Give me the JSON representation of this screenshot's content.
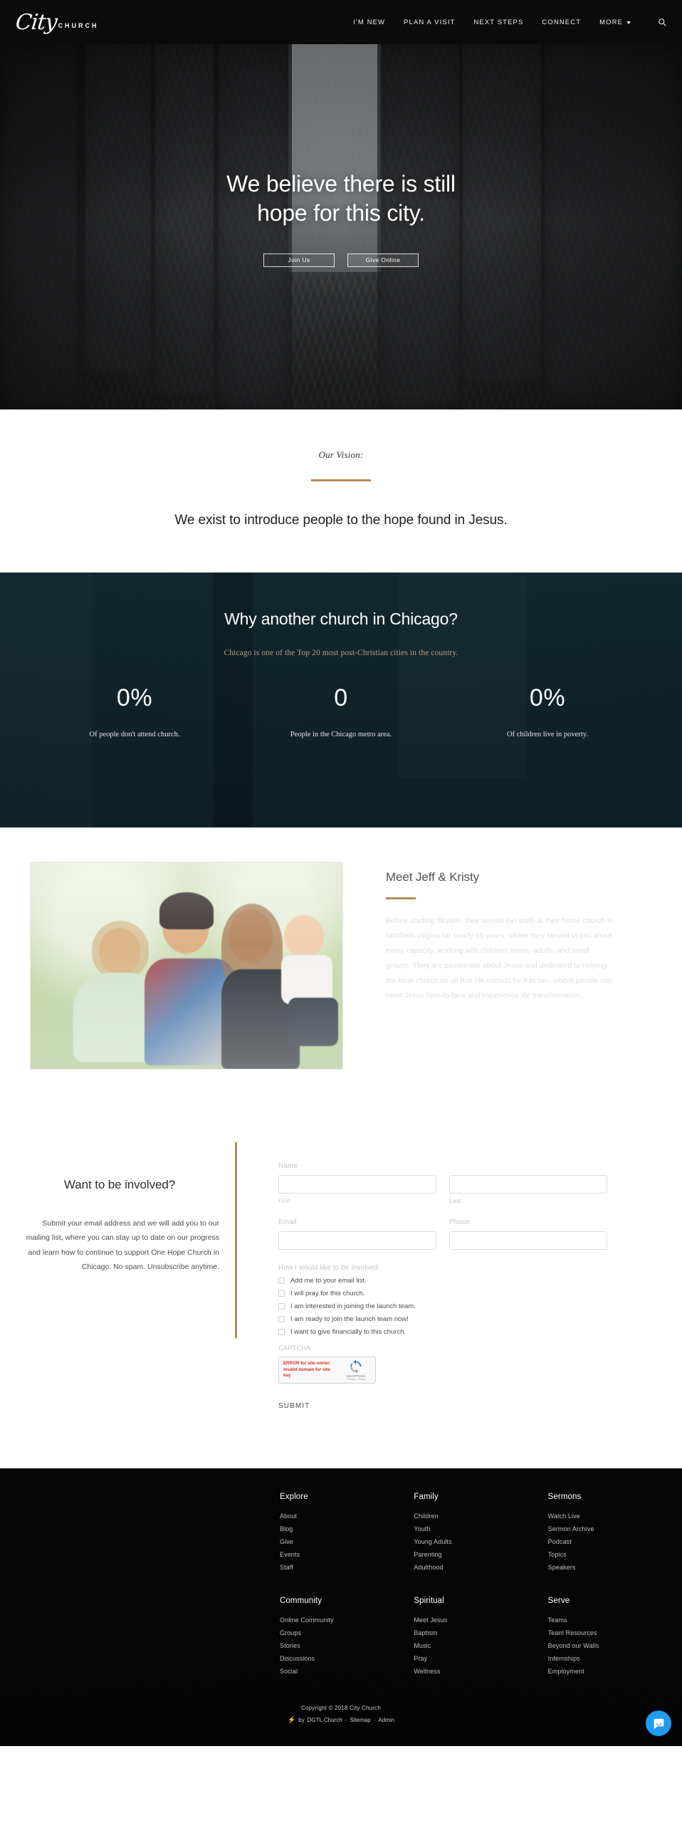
{
  "header": {
    "brand_script": "City",
    "brand_sub": "CHURCH",
    "nav": [
      {
        "label": "I'M NEW",
        "has_chevron": false
      },
      {
        "label": "PLAN A VISIT",
        "has_chevron": false
      },
      {
        "label": "NEXT STEPS",
        "has_chevron": false
      },
      {
        "label": "CONNECT",
        "has_chevron": false
      },
      {
        "label": "MORE",
        "has_chevron": true
      }
    ],
    "search_icon": "search-icon"
  },
  "hero": {
    "title_line1": "We believe there is still",
    "title_line2": "hope for this city.",
    "btn_join": "Join Us",
    "btn_give": "Give Online"
  },
  "vision": {
    "eyebrow": "Our Vision:",
    "statement": "We exist to introduce people to the hope found in Jesus.",
    "accent_color": "#b08d57"
  },
  "stats": {
    "title": "Why another church in Chicago?",
    "subtitle": "Chicago is one of the Top 20 most post-Christian cities in the country.",
    "subtitle_color": "#b3a07c",
    "items": [
      {
        "value": "0%",
        "label": "Of people don't attend church."
      },
      {
        "value": "0",
        "label": "People in the Chicago metro area."
      },
      {
        "value": "0%",
        "label": "Of children live in poverty."
      }
    ]
  },
  "meet": {
    "photo_alt": "family-photo",
    "title": "Meet Jeff & Kristy",
    "body": "Before starting Skyline, they served (on staff) at their home church in Northern Virgina for nearly 15 years, where they served in just about every capacity, working with children, teens, adults, and small groups. They are passionate about Jesus and dedicated to helping the local church be all that He intends for it to be—where people can meet Jesus face-to-face and experience life transformation."
  },
  "involve": {
    "title": "Want to be involved?",
    "copy": "Submit your email address and we will add you to our mailing list, where you can stay up to date on our progress and learn how to continue to support One Hope Church in Chicago. No spam. Unsubscribe anytime.",
    "form": {
      "name_label": "Name",
      "first_sub": "First",
      "last_sub": "Last",
      "first_value": "",
      "last_value": "",
      "email_label": "Email",
      "email_value": "",
      "phone_label": "Phone",
      "phone_value": "",
      "involved_label": "How I would like to be involved:",
      "checkboxes": [
        {
          "label": "Add me to your email list.",
          "checked": false
        },
        {
          "label": "I will pray for this church.",
          "checked": false
        },
        {
          "label": "I am interested in joining the launch team.",
          "checked": false
        },
        {
          "label": "I am ready to join the launch team now!",
          "checked": false
        },
        {
          "label": "I want to give financially to this church.",
          "checked": false
        }
      ],
      "captcha_label": "CAPTCHA",
      "captcha_error_line1": "ERROR for site owner:",
      "captcha_error_line2": "Invalid domain for site key",
      "captcha_brand": "reCAPTCHA",
      "captcha_terms": "Privacy - Terms",
      "captcha_error_color": "#d93025",
      "submit_label": "SUBMIT"
    }
  },
  "footer": {
    "columns_row1": [
      {
        "title": "Explore",
        "links": [
          "About",
          "Blog",
          "Give",
          "Events",
          "Staff"
        ]
      },
      {
        "title": "Family",
        "links": [
          "Children",
          "Youth",
          "Young Adults",
          "Parenting",
          "Adulthood"
        ]
      },
      {
        "title": "Sermons",
        "links": [
          "Watch Live",
          "Sermon Archive",
          "Podcast",
          "Topics",
          "Speakers"
        ]
      }
    ],
    "columns_row2": [
      {
        "title": "Community",
        "links": [
          "Online Community",
          "Groups",
          "Stories",
          "Discussions",
          "Social"
        ]
      },
      {
        "title": "Spiritual",
        "links": [
          "Meet Jesus",
          "Baptism",
          "Music",
          "Pray",
          "Wellness"
        ]
      },
      {
        "title": "Serve",
        "links": [
          "Teams",
          "Team Resources",
          "Beyond our Walls",
          "Internships",
          "Employment"
        ]
      }
    ],
    "copyright": "Copyright © 2018 City Church",
    "by_prefix": "by",
    "by_name": "DGTL Church",
    "sep1": "·",
    "sitemap": "Sitemap",
    "sep2": "·",
    "admin": "Admin",
    "bolt_icon": "lightning-bolt-icon"
  },
  "chat": {
    "icon": "chat-bubble-icon",
    "color": "#1f9bf0"
  }
}
